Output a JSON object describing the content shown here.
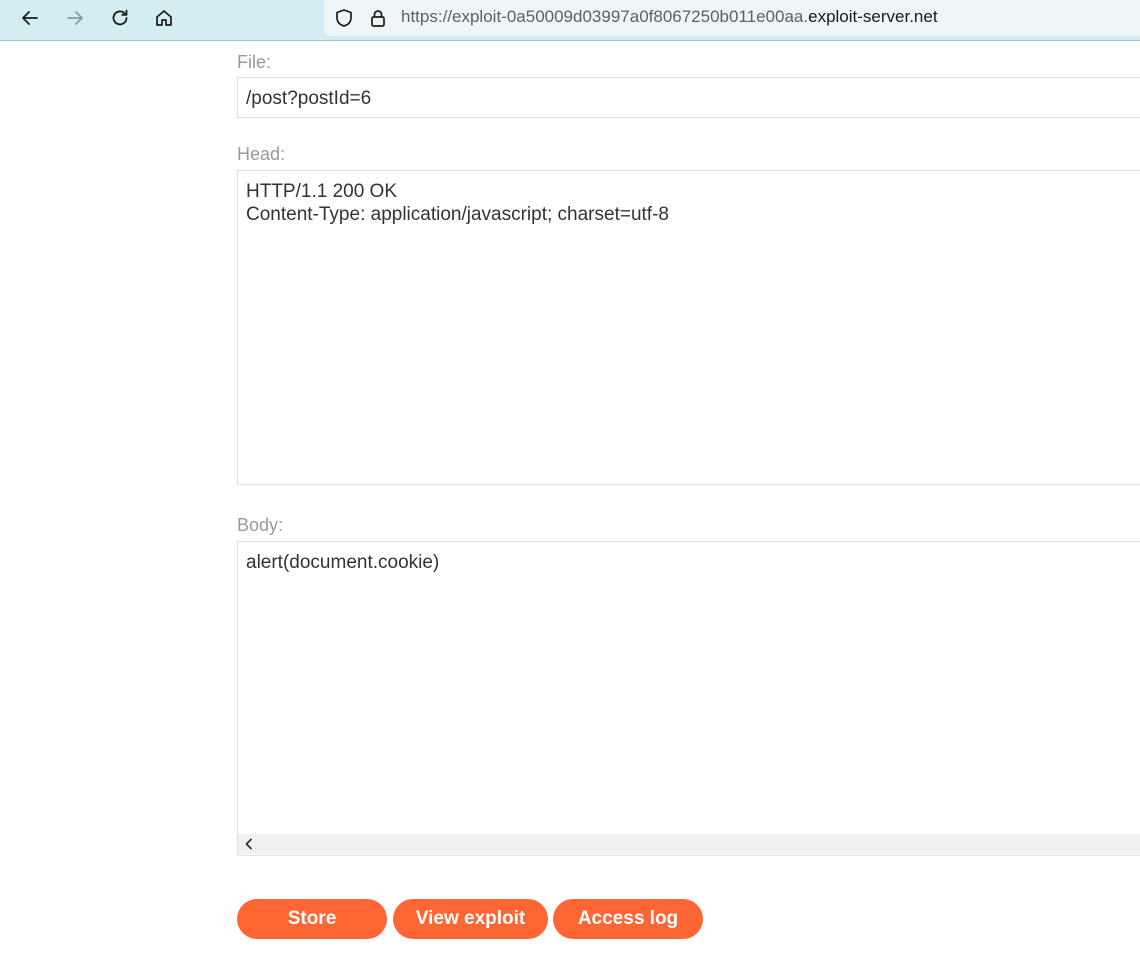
{
  "browser": {
    "url_scheme_part": "https://exploit-0a50009d03997a0f8067250b011e00aa.",
    "url_domain_part": "exploit-server.net",
    "icons": [
      "back-arrow-icon",
      "forward-arrow-icon",
      "reload-icon",
      "home-icon",
      "shield-icon",
      "lock-icon"
    ]
  },
  "form": {
    "file_label": "File:",
    "file_value": "/post?postId=6",
    "head_label": "Head:",
    "head_value": "HTTP/1.1 200 OK\nContent-Type: application/javascript; charset=utf-8",
    "body_label": "Body:",
    "body_value": "alert(document.cookie)"
  },
  "buttons": {
    "store": "Store",
    "view_exploit": "View exploit",
    "access_log": "Access log"
  },
  "colors": {
    "accent": "#ff6633",
    "toolbar": "#d3eef1",
    "label": "#999999"
  }
}
